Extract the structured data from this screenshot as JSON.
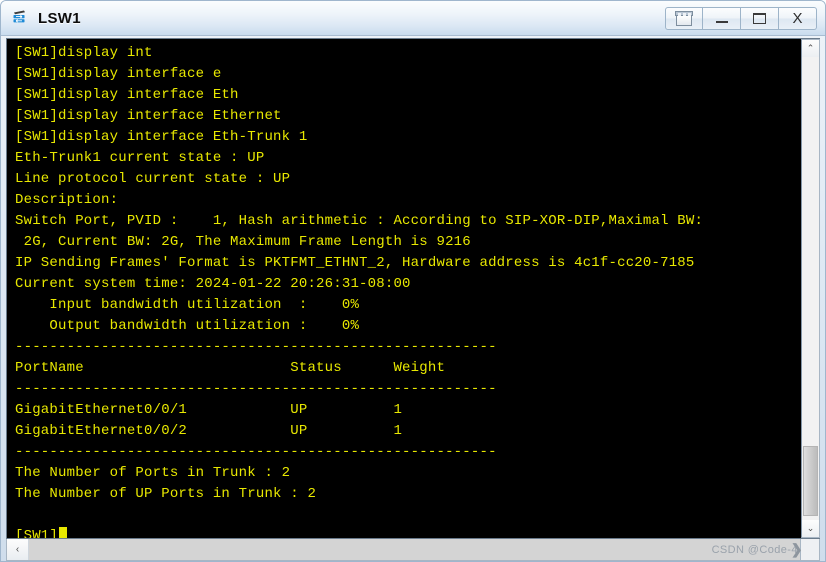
{
  "window": {
    "title": "LSW1",
    "icon": "switch-icon",
    "buttons": [
      {
        "name": "restore-button",
        "label": ""
      },
      {
        "name": "minimize-button",
        "label": ""
      },
      {
        "name": "maximize-button",
        "label": ""
      },
      {
        "name": "close-button",
        "label": "X"
      }
    ]
  },
  "terminal": {
    "foreground_color": "#e8e800",
    "background_color": "#000000",
    "lines": [
      "[SW1]display int",
      "[SW1]display interface e",
      "[SW1]display interface Eth",
      "[SW1]display interface Ethernet",
      "[SW1]display interface Eth-Trunk 1",
      "Eth-Trunk1 current state : UP",
      "Line protocol current state : UP",
      "Description:",
      "Switch Port, PVID :    1, Hash arithmetic : According to SIP-XOR-DIP,Maximal BW:",
      " 2G, Current BW: 2G, The Maximum Frame Length is 9216",
      "IP Sending Frames' Format is PKTFMT_ETHNT_2, Hardware address is 4c1f-cc20-7185",
      "Current system time: 2024-01-22 20:26:31-08:00",
      "    Input bandwidth utilization  :    0%",
      "    Output bandwidth utilization :    0%",
      "--------------------------------------------------------",
      "PortName                        Status      Weight",
      "--------------------------------------------------------",
      "GigabitEthernet0/0/1            UP          1",
      "GigabitEthernet0/0/2            UP          1",
      "--------------------------------------------------------",
      "The Number of Ports in Trunk : 2",
      "The Number of UP Ports in Trunk : 2",
      ""
    ],
    "prompt": "[SW1]"
  },
  "scrollbars": {
    "vertical": {
      "up_arrow": "⌃",
      "down_arrow": "⌄"
    },
    "horizontal": {
      "left_arrow": "‹",
      "right_arrow": "›"
    }
  },
  "watermark": {
    "text": "CSDN @Code-4",
    "arrow": "❯"
  }
}
